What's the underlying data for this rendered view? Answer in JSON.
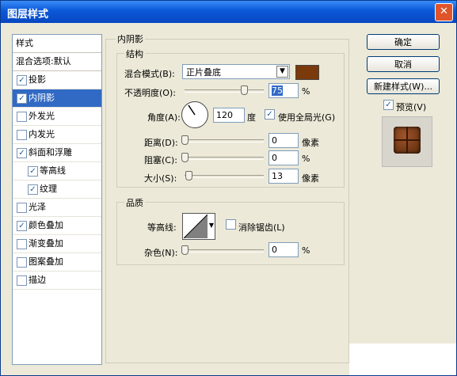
{
  "window": {
    "title": "图层样式",
    "close": "✕"
  },
  "styles_panel": {
    "header": "样式",
    "blend_default": "混合选项:默认",
    "items": [
      {
        "label": "投影",
        "checked": true
      },
      {
        "label": "内阴影",
        "checked": true,
        "selected": true
      },
      {
        "label": "外发光",
        "checked": false
      },
      {
        "label": "内发光",
        "checked": false
      },
      {
        "label": "斜面和浮雕",
        "checked": true
      },
      {
        "label": "等高线",
        "checked": true,
        "sub": true
      },
      {
        "label": "纹理",
        "checked": true,
        "sub": true
      },
      {
        "label": "光泽",
        "checked": false
      },
      {
        "label": "颜色叠加",
        "checked": true
      },
      {
        "label": "渐变叠加",
        "checked": false
      },
      {
        "label": "图案叠加",
        "checked": false
      },
      {
        "label": "描边",
        "checked": false
      }
    ]
  },
  "inner_shadow": {
    "group_title": "内阴影",
    "structure": {
      "title": "结构",
      "blend_mode_label": "混合模式(B):",
      "blend_mode_value": "正片叠底",
      "color": "#7a3a0c",
      "opacity_label": "不透明度(O):",
      "opacity_value": "75",
      "percent": "%",
      "angle_label": "角度(A):",
      "angle_value": "120",
      "degree": "度",
      "global_light_label": "使用全局光(G)",
      "global_light_checked": true,
      "distance_label": "距离(D):",
      "distance_value": "0",
      "distance_unit": "像素",
      "choke_label": "阻塞(C):",
      "choke_value": "0",
      "choke_unit": "%",
      "size_label": "大小(S):",
      "size_value": "13",
      "size_unit": "像素"
    },
    "quality": {
      "title": "品质",
      "contour_label": "等高线:",
      "anti_alias_label": "消除锯齿(L)",
      "anti_alias_checked": false,
      "noise_label": "杂色(N):",
      "noise_value": "0",
      "noise_unit": "%"
    }
  },
  "buttons": {
    "ok": "确定",
    "cancel": "取消",
    "new_style": "新建样式(W)...",
    "preview_label": "预览(V)",
    "preview_checked": true
  },
  "sliders": {
    "opacity": 0.75,
    "distance": 0,
    "choke": 0,
    "size": 0.05,
    "noise": 0
  }
}
